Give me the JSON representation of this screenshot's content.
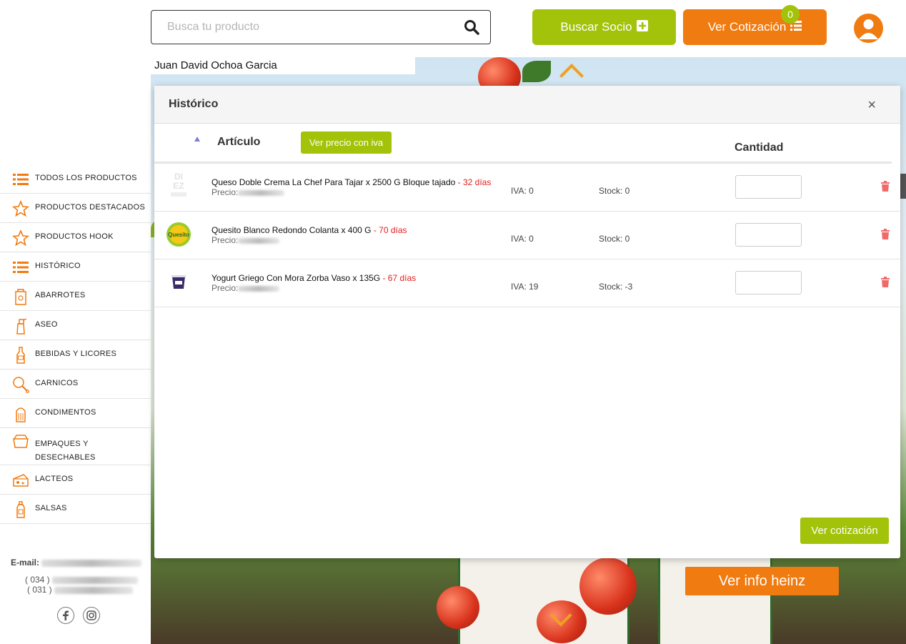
{
  "header": {
    "search_placeholder": "Busca tu producto",
    "buscar_socio_label": "Buscar Socio",
    "ver_cotizacion_label": "Ver Cotización",
    "cart_count": "0"
  },
  "user": {
    "name": "Juan David Ochoa Garcia"
  },
  "sidebar": {
    "items": [
      {
        "label": "TODOS LOS PRODUCTOS",
        "icon": "list-icon"
      },
      {
        "label": "PRODUCTOS DESTACADOS",
        "icon": "star-icon"
      },
      {
        "label": "PRODUCTOS HOOK",
        "icon": "star-icon"
      },
      {
        "label": "HISTÓRICO",
        "icon": "list-icon"
      },
      {
        "label": "ABARROTES",
        "icon": "grocery-bag-icon"
      },
      {
        "label": "ASEO",
        "icon": "spray-bottle-icon"
      },
      {
        "label": "BEBIDAS Y LICORES",
        "icon": "bottle-icon"
      },
      {
        "label": "CARNICOS",
        "icon": "meat-leg-icon"
      },
      {
        "label": "CONDIMENTOS",
        "icon": "salt-shaker-icon"
      },
      {
        "label": "EMPAQUES Y DESECHABLES",
        "icon": "container-icon"
      },
      {
        "label": "LACTEOS",
        "icon": "cheese-icon"
      },
      {
        "label": "SALSAS",
        "icon": "sauce-bottle-icon"
      }
    ]
  },
  "contact": {
    "email_label": "E-mail:",
    "phone1_prefix": "( 034 )",
    "phone2_prefix": "( 031 )"
  },
  "modal": {
    "title": "Histórico",
    "close_label": "×",
    "col_articulo": "Artículo",
    "iva_button": "Ver precio con iva",
    "col_cantidad": "Cantidad",
    "ver_cotizacion": "Ver cotización",
    "rows": [
      {
        "name": "Queso Doble Crema La Chef Para Tajar x 2500 G Bloque tajado",
        "days": " - 32 días",
        "price_label": "Precio:",
        "iva": "IVA: 0",
        "stock": "Stock: 0"
      },
      {
        "name": "Quesito Blanco Redondo Colanta x 400 G",
        "days": " - 70 días",
        "price_label": "Precio:",
        "iva": "IVA: 0",
        "stock": "Stock: 0"
      },
      {
        "name": "Yogurt Griego Con Mora Zorba Vaso x 135G",
        "days": " - 67 días",
        "price_label": "Precio:",
        "iva": "IVA: 19",
        "stock": "Stock: -3"
      }
    ]
  },
  "hero": {
    "info_button": "Ver info heinz"
  },
  "colors": {
    "green": "#a3c20a",
    "orange": "#f07b10",
    "red": "#e02020"
  }
}
